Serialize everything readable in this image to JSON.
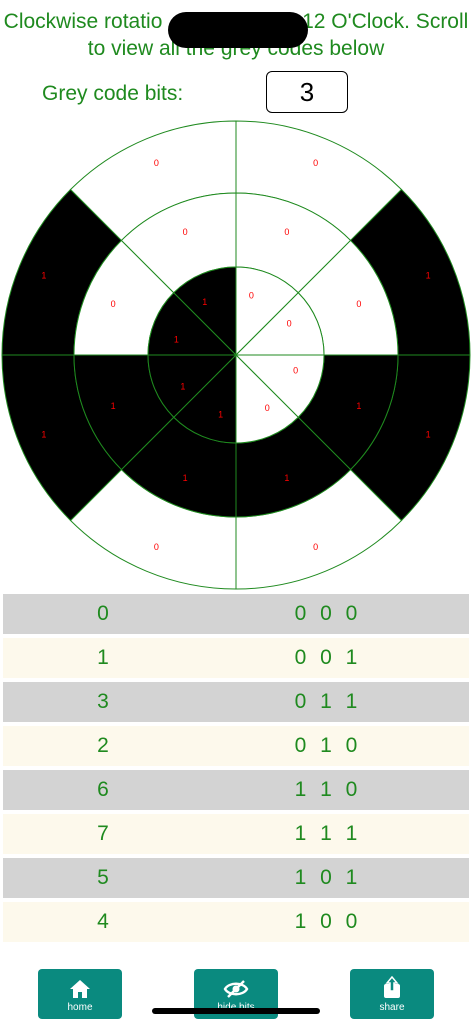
{
  "header": {
    "line1_visible_left": "Clockwise rotatio",
    "line1_visible_right": "12 O'Clock. Scroll",
    "line2": "to view all the grey codes below"
  },
  "bits": {
    "label": "Grey code bits:",
    "value": "3"
  },
  "wheel": {
    "outer_ring_labels": [
      "0",
      "1",
      "1",
      "0",
      "0",
      "1",
      "1",
      "0"
    ],
    "middle_ring_labels": [
      "0",
      "0",
      "1",
      "1",
      "1",
      "1",
      "0",
      "0"
    ],
    "inner_ring_labels": [
      "0",
      "0",
      "0",
      "0",
      "1",
      "1",
      "1",
      "1"
    ]
  },
  "rows": [
    {
      "decimal": "0",
      "code": "0 0 0"
    },
    {
      "decimal": "1",
      "code": "0 0 1"
    },
    {
      "decimal": "3",
      "code": "0 1 1"
    },
    {
      "decimal": "2",
      "code": "0 1 0"
    },
    {
      "decimal": "6",
      "code": "1 1 0"
    },
    {
      "decimal": "7",
      "code": "1 1 1"
    },
    {
      "decimal": "5",
      "code": "1 0 1"
    },
    {
      "decimal": "4",
      "code": "1 0 0"
    }
  ],
  "buttons": {
    "home": "home",
    "hide_bits": "hide bits",
    "share": "share"
  },
  "colors": {
    "text_green": "#1f8a1f",
    "button_teal": "#0a8a7f",
    "label_red": "#ff0000"
  }
}
